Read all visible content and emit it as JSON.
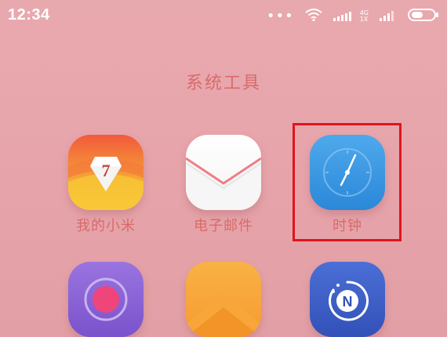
{
  "status_bar": {
    "time": "12:34",
    "net_top": "4G",
    "net_bottom": "1X",
    "icons": [
      "more-dots-icon",
      "wifi-icon",
      "signal-icon",
      "signal-icon",
      "battery-icon"
    ]
  },
  "folder": {
    "title": "系统工具"
  },
  "apps": [
    {
      "label": "我的小米",
      "icon": "mi-diamond-icon",
      "badge": "7"
    },
    {
      "label": "电子邮件",
      "icon": "envelope-icon"
    },
    {
      "label": "时钟",
      "icon": "clock-icon"
    },
    {
      "label": "",
      "icon": "record-icon"
    },
    {
      "label": "",
      "icon": "up-arrow-icon"
    },
    {
      "label": "",
      "icon": "navigation-n-icon",
      "badge": "N"
    }
  ],
  "colors": {
    "background": "#e8a9ae",
    "label_text": "#d96a6a",
    "highlight": "#e0141c"
  }
}
